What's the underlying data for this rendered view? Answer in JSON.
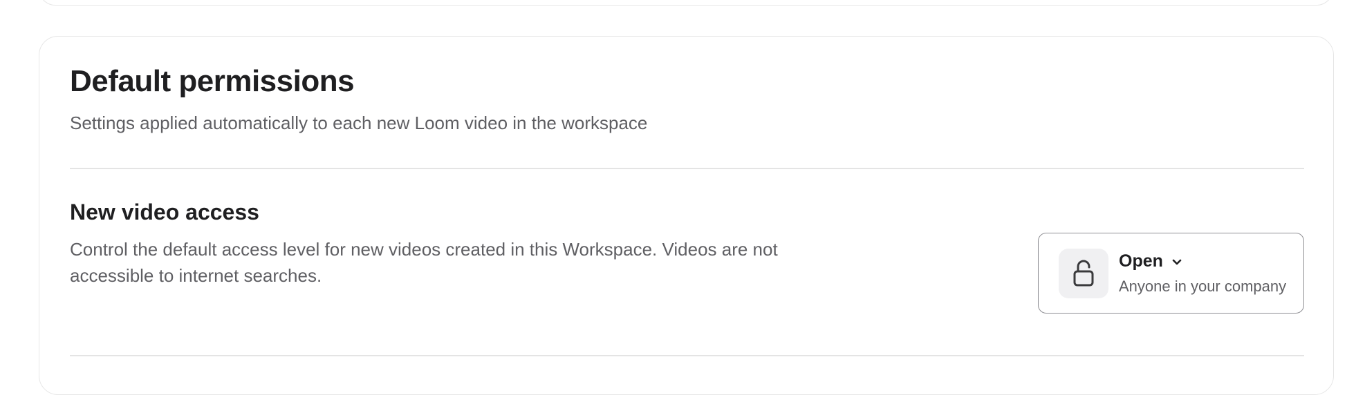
{
  "permissions": {
    "title": "Default permissions",
    "subtitle": "Settings applied automatically to each new Loom video in the workspace"
  },
  "new_video_access": {
    "title": "New video access",
    "description": "Control the default access level for new videos created in this Workspace. Videos are not accessible to internet searches.",
    "selector": {
      "icon": "unlock-icon",
      "value": "Open",
      "sublabel": "Anyone in your company",
      "chevron": "chevron-down-icon"
    }
  }
}
